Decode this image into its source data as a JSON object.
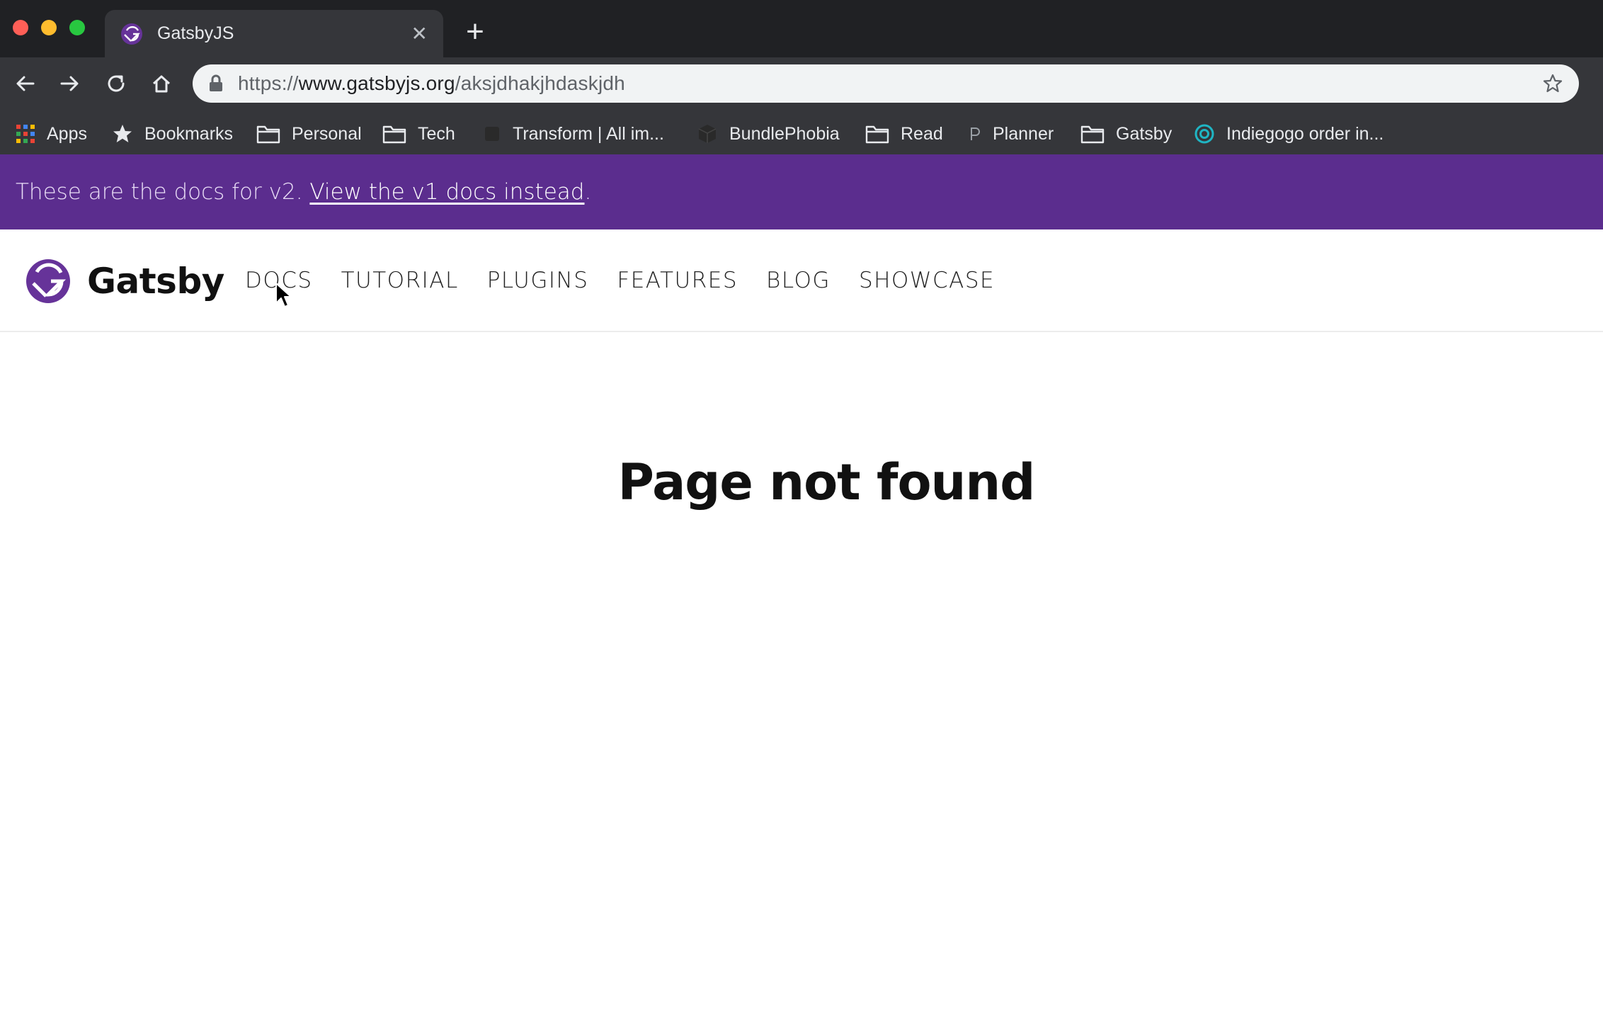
{
  "browser": {
    "tab": {
      "title": "GatsbyJS",
      "close": "✕"
    },
    "new_tab": "+",
    "url": {
      "scheme": "https://",
      "host": "www.gatsbyjs.org",
      "path": "/aksjdhakjhdaskjdh"
    },
    "bookmarks": [
      {
        "label": "Apps",
        "icon": "apps-grid-icon"
      },
      {
        "label": "Bookmarks",
        "icon": "star-icon"
      },
      {
        "label": "Personal",
        "icon": "folder-icon"
      },
      {
        "label": "Tech",
        "icon": "folder-icon"
      },
      {
        "label": "Transform | All im...",
        "icon": "transform-icon"
      },
      {
        "label": "BundlePhobia",
        "icon": "box-icon"
      },
      {
        "label": "Read",
        "icon": "folder-icon"
      },
      {
        "label": "Planner",
        "icon": "planner-icon"
      },
      {
        "label": "Gatsby",
        "icon": "folder-icon"
      },
      {
        "label": "Indiegogo order in...",
        "icon": "indiegogo-icon"
      }
    ]
  },
  "banner": {
    "text": "These are the docs for v2. ",
    "link": "View the v1 docs instead",
    "suffix": "."
  },
  "site": {
    "logo_text": "Gatsby",
    "brand_color": "#663399",
    "nav": [
      "DOCS",
      "TUTORIAL",
      "PLUGINS",
      "FEATURES",
      "BLOG",
      "SHOWCASE"
    ]
  },
  "main": {
    "heading": "Page not found"
  }
}
